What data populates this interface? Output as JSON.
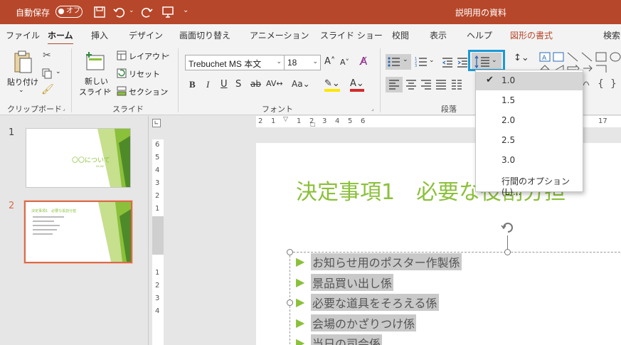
{
  "titlebar": {
    "autosave_label": "自動保存",
    "autosave_state": "オフ",
    "document_title": "説明用の資料"
  },
  "tabs": [
    {
      "label": "ファイル"
    },
    {
      "label": "ホーム"
    },
    {
      "label": "挿入"
    },
    {
      "label": "デザイン"
    },
    {
      "label": "画面切り替え"
    },
    {
      "label": "アニメーション"
    },
    {
      "label": "スライド ショー"
    },
    {
      "label": "校閲"
    },
    {
      "label": "表示"
    },
    {
      "label": "ヘルプ"
    },
    {
      "label": "図形の書式"
    },
    {
      "label": "検索"
    }
  ],
  "ribbon": {
    "clipboard": {
      "paste": "貼り付け",
      "label": "クリップボード"
    },
    "slides": {
      "new_slide_1": "新しい",
      "new_slide_2": "スライド",
      "layout": "レイアウト",
      "reset": "リセット",
      "section": "セクション",
      "label": "スライド"
    },
    "font": {
      "name": "Trebuchet MS 本文",
      "size": "18",
      "label": "フォント"
    },
    "paragraph": {
      "label": "段落"
    }
  },
  "thumbnails": [
    {
      "num": "1",
      "title": "〇〇について",
      "subtitle": "xx.xx"
    },
    {
      "num": "2",
      "title": "決定事項1　必要な役割分担"
    }
  ],
  "ruler": {
    "h_ticks": [
      "2",
      "1",
      "1",
      "2",
      "3",
      "4",
      "5",
      "6",
      "17"
    ],
    "v_ticks": [
      "6",
      "5",
      "4",
      "3",
      "2",
      "1",
      "1",
      "2",
      "3",
      "4"
    ]
  },
  "slide": {
    "title": "決定事項1　必要な役割分担",
    "bullets": [
      "お知らせ用のポスター作製係",
      "景品買い出し係",
      "必要な道具をそろえる係",
      "会場のかざりつけ係",
      "当日の司会係"
    ]
  },
  "line_spacing_menu": {
    "options": [
      "1.0",
      "1.5",
      "2.0",
      "2.5",
      "3.0"
    ],
    "selected": "1.0",
    "more": "行間のオプション(L)..."
  },
  "colors": {
    "accent": "#b7472a",
    "title_green": "#8bc03a",
    "highlight": "#1a9ad6"
  }
}
